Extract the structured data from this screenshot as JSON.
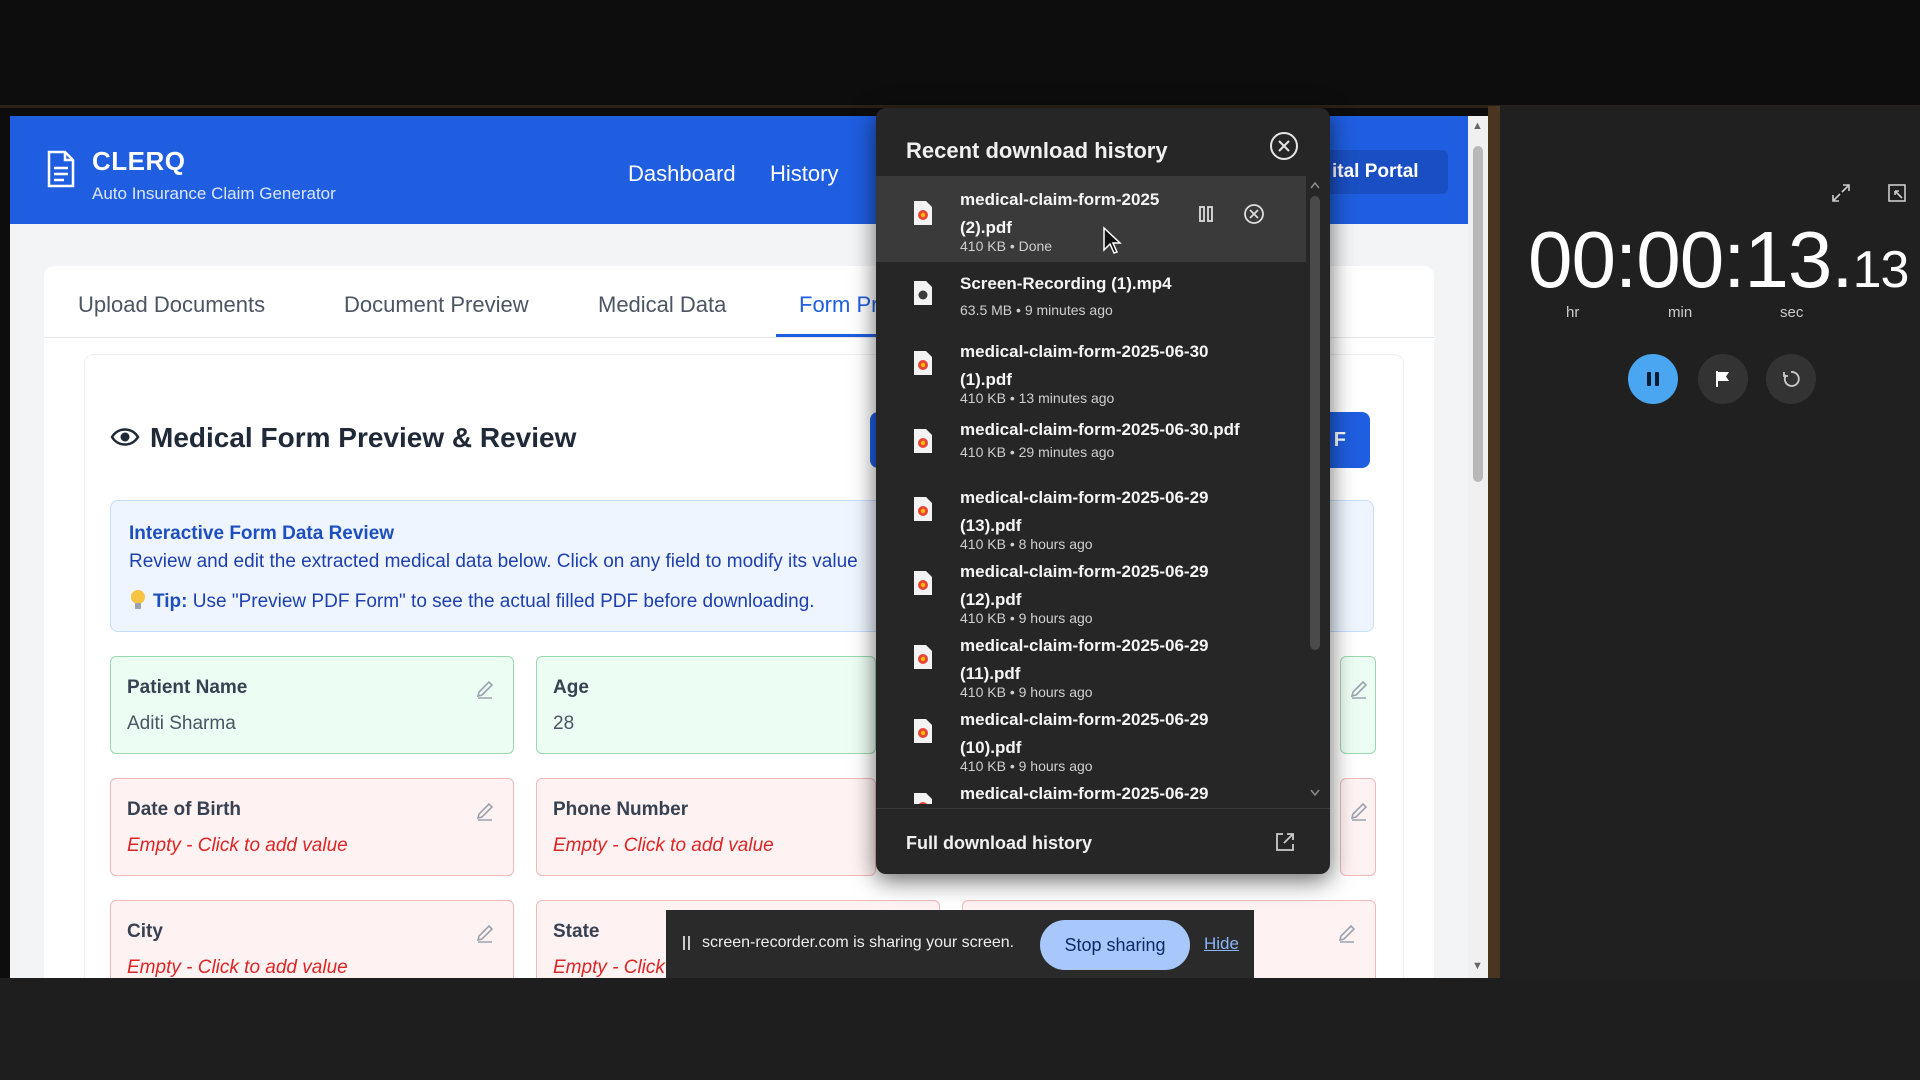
{
  "app": {
    "brand_name": "CLERQ",
    "brand_sub": "Auto Insurance Claim Generator",
    "nav": [
      "Dashboard",
      "History"
    ],
    "portal_button": "ital Portal"
  },
  "tabs": [
    "Upload Documents",
    "Document Preview",
    "Medical Data",
    "Form Pr"
  ],
  "active_tab": 3,
  "preview": {
    "title": "Medical Form Preview & Review",
    "button_label": "F"
  },
  "info_box": {
    "title": "Interactive Form Data Review",
    "text": "Review and edit the extracted medical data below. Click on any field to modify its value",
    "tip_label": "Tip:",
    "tip_text": "Use \"Preview PDF Form\" to see the actual filled PDF before downloading."
  },
  "fields": [
    {
      "label": "Patient Name",
      "value": "Aditi Sharma",
      "status": "filled"
    },
    {
      "label": "Age",
      "value": "28",
      "status": "filled"
    },
    {
      "label": "Date of Birth",
      "value": "Empty - Click to add value",
      "status": "empty"
    },
    {
      "label": "Phone Number",
      "value": "Empty - Click to add value",
      "status": "empty"
    },
    {
      "label": "City",
      "value": "Empty - Click to add value",
      "status": "empty"
    },
    {
      "label": "State",
      "value": "Empty - Click",
      "status": "empty"
    }
  ],
  "downloads": {
    "title": "Recent download history",
    "footer": "Full download history",
    "items": [
      {
        "name": "medical-claim-form-2025 (2).pdf",
        "meta": "410 KB • Done",
        "icon": "pdf-icon"
      },
      {
        "name": "Screen-Recording (1).mp4",
        "meta": "63.5 MB • 9 minutes ago",
        "icon": "video-icon"
      },
      {
        "name": "medical-claim-form-2025-06-30 (1).pdf",
        "meta": "410 KB • 13 minutes ago",
        "icon": "pdf-icon"
      },
      {
        "name": "medical-claim-form-2025-06-30.pdf",
        "meta": "410 KB • 29 minutes ago",
        "icon": "pdf-icon"
      },
      {
        "name": "medical-claim-form-2025-06-29 (13).pdf",
        "meta": "410 KB • 8 hours ago",
        "icon": "pdf-icon"
      },
      {
        "name": "medical-claim-form-2025-06-29 (12).pdf",
        "meta": "410 KB • 9 hours ago",
        "icon": "pdf-icon"
      },
      {
        "name": "medical-claim-form-2025-06-29 (11).pdf",
        "meta": "410 KB • 9 hours ago",
        "icon": "pdf-icon"
      },
      {
        "name": "medical-claim-form-2025-06-29 (10).pdf",
        "meta": "410 KB • 9 hours ago",
        "icon": "pdf-icon"
      },
      {
        "name": "medical-claim-form-2025-06-29",
        "meta": "",
        "icon": "pdf-icon"
      }
    ]
  },
  "share_bar": {
    "text": "screen-recorder.com is sharing your screen.",
    "stop_label": "Stop sharing",
    "hide_label": "Hide"
  },
  "stopwatch": {
    "time_main": "00:00:13.",
    "time_ms": "13",
    "labels": [
      "hr",
      "min",
      "sec"
    ]
  },
  "colors": {
    "brand_blue": "#1f5ee0",
    "filled_green": "#ecfdf3",
    "empty_red": "#fef2f2",
    "panel_dark": "#262626",
    "stopwatch_accent": "#4aa6f0"
  }
}
